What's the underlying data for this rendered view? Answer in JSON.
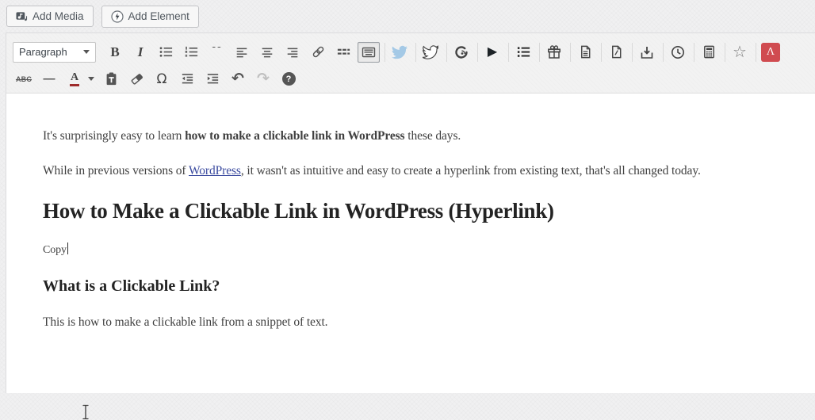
{
  "colors": {
    "page_background": "#f0f0f1",
    "toolbar_background": "#f2f2f2",
    "accent_red_tile": "#d04b50",
    "link_blue": "#3a4a9f",
    "twitter_blue": "#a4c9e6",
    "text_color_bar": "#9e2b2b"
  },
  "top_bar": {
    "add_media": "Add Media",
    "add_element": "Add Element"
  },
  "toolbar": {
    "format_select_value": "Paragraph",
    "glyphs": {
      "bold": "B",
      "italic": "I",
      "blockquote": "“",
      "strikethrough": "ABC",
      "horizontal_rule": "—",
      "text_color": "A",
      "special_character": "Ω",
      "play": "▶",
      "star": "☆",
      "undo": "↶",
      "redo": "↷",
      "help": "?",
      "lambda": "Λ"
    },
    "row1_icons": [
      "format-select",
      "bold",
      "italic",
      "bulleted-list",
      "numbered-list",
      "blockquote",
      "align-left",
      "align-center",
      "align-right",
      "link",
      "read-more",
      "toolbar-toggle (active)",
      "twitter-bird-blue",
      "twitter-bird-outline",
      "follow-signal",
      "play",
      "bold-list",
      "gift",
      "document",
      "document-slash",
      "download",
      "clock",
      "calculator",
      "star",
      "red-lambda-tile"
    ],
    "row2_icons": [
      "strikethrough",
      "horizontal-rule",
      "text-color",
      "text-color-dropdown",
      "paste-as-text",
      "clear-formatting",
      "special-character",
      "outdent",
      "indent",
      "undo",
      "redo (disabled)",
      "help"
    ]
  },
  "editor": {
    "p1_pre": "It's surprisingly easy to learn ",
    "p1_bold": "how to make a clickable link in WordPress",
    "p1_post": " these days.",
    "p2_pre": "While in previous versions of ",
    "p2_link": "WordPress",
    "p2_post": ", it wasn't as intuitive and easy to create a hyperlink from existing text, that's all changed today.",
    "h2": "How to Make a Clickable Link in WordPress (Hyperlink)",
    "copy_text": "Copy",
    "h3": "What is a Clickable Link?",
    "p3": "This is how to make a clickable link from a snippet of text."
  }
}
